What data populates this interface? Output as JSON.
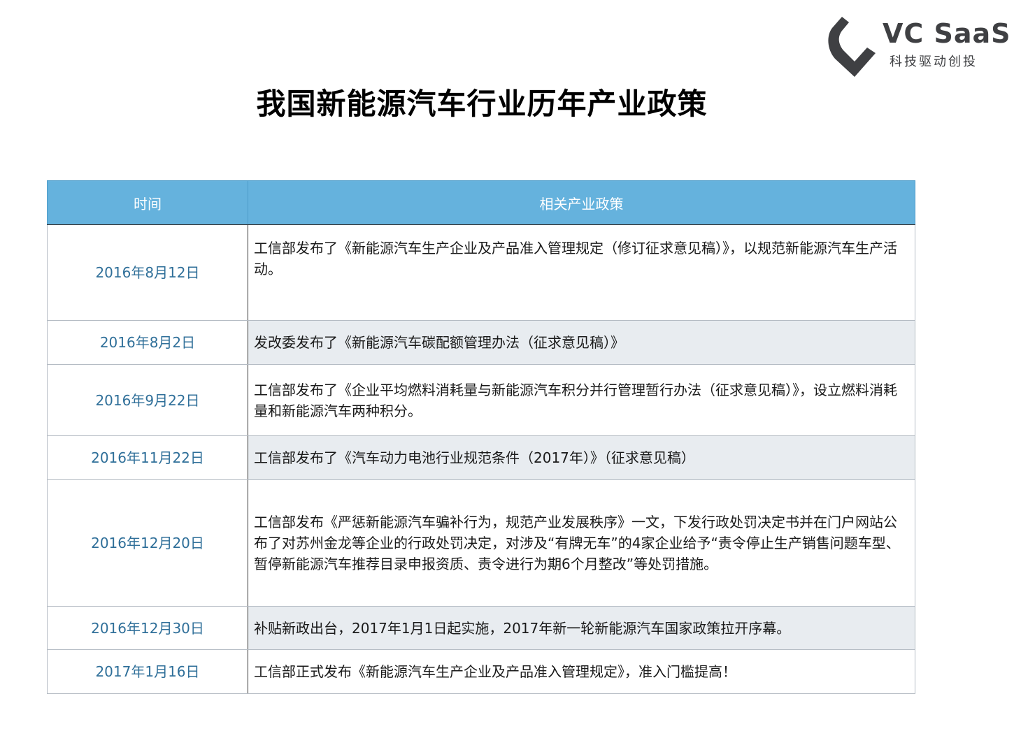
{
  "logo": {
    "name": "VC SaaS",
    "tagline": "科技驱动创投",
    "mark_color": "#3f4043"
  },
  "page_title": "我国新能源汽车行业历年产业政策",
  "table": {
    "header_color": "#65b2dd",
    "columns": [
      "时间",
      "相关产业政策"
    ],
    "rows": [
      {
        "date": "2016年8月12日",
        "policy": "工信部发布了《新能源汽车生产企业及产品准入管理规定（修订征求意见稿）》，以规范新能源汽车生产活动。"
      },
      {
        "date": "2016年8月2日",
        "policy": "发改委发布了《新能源汽车碳配额管理办法（征求意见稿）》"
      },
      {
        "date": "2016年9月22日",
        "policy": "工信部发布了《企业平均燃料消耗量与新能源汽车积分并行管理暂行办法（征求意见稿）》，设立燃料消耗量和新能源汽车两种积分。"
      },
      {
        "date": "2016年11月22日",
        "policy": "工信部发布了《汽车动力电池行业规范条件（2017年）》（征求意见稿）"
      },
      {
        "date": "2016年12月20日",
        "policy": "工信部发布《严惩新能源汽车骗补行为，规范产业发展秩序》一文，下发行政处罚决定书并在门户网站公布了对苏州金龙等企业的行政处罚决定，对涉及“有牌无车”的4家企业给予“责令停止生产销售问题车型、暂停新能源汽车推荐目录申报资质、责令进行为期6个月整改”等处罚措施。"
      },
      {
        "date": "2016年12月30日",
        "policy": "补贴新政出台，2017年1月1日起实施，2017年新一轮新能源汽车国家政策拉开序幕。"
      },
      {
        "date": "2017年1月16日",
        "policy": "工信部正式发布《新能源汽车生产企业及产品准入管理规定》，准入门槛提高！"
      }
    ]
  }
}
